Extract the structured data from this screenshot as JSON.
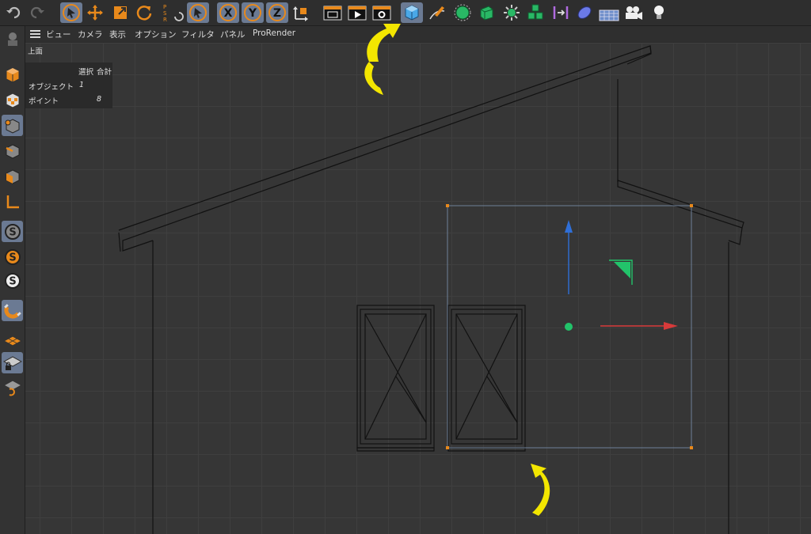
{
  "toolbar": {
    "undo": "undo-icon",
    "redo": "redo-icon",
    "tools": [
      "select-tool",
      "move-tool",
      "scale-tool",
      "rotate-tool"
    ],
    "coord_labels": {
      "p": "P",
      "s": "S",
      "r": "R"
    },
    "axis_locks": {
      "x": "X",
      "y": "Y",
      "z": "Z"
    },
    "render": [
      "render-view",
      "render-to-picture-viewer",
      "render-settings"
    ],
    "objects": [
      "cube-primitive",
      "pen-spline",
      "subdivision-surface",
      "extrude",
      "cloner",
      "array",
      "symmetry",
      "deformer",
      "floor",
      "camera",
      "light"
    ]
  },
  "menubar": {
    "items": [
      "ビュー",
      "カメラ",
      "表示",
      "オプション",
      "フィルタ",
      "パネル",
      "ProRender"
    ]
  },
  "viewport": {
    "label": "上面",
    "hud": {
      "header_left": "選択",
      "header_right": "合計",
      "rows": [
        {
          "label": "オブジェクト",
          "value": "1"
        },
        {
          "label": "ポイント",
          "value": "8"
        }
      ]
    }
  },
  "leftbar": {
    "modes": [
      "model-mode",
      "texture-mode",
      "point-mode",
      "edge-mode",
      "polygon-mode",
      "axis-mode",
      "snap-settings",
      "snap-enable",
      "snap-lock",
      "magnet-icon",
      "workplane",
      "locked-workplane",
      "workplane-align"
    ]
  },
  "colors": {
    "accent_orange": "#e8891b",
    "selection_blue": "#6b7a93",
    "annotation_yellow": "#f3e600",
    "axis_y": "#2f6fd8",
    "axis_x": "#d83a3a",
    "axis_z": "#22c36a"
  }
}
